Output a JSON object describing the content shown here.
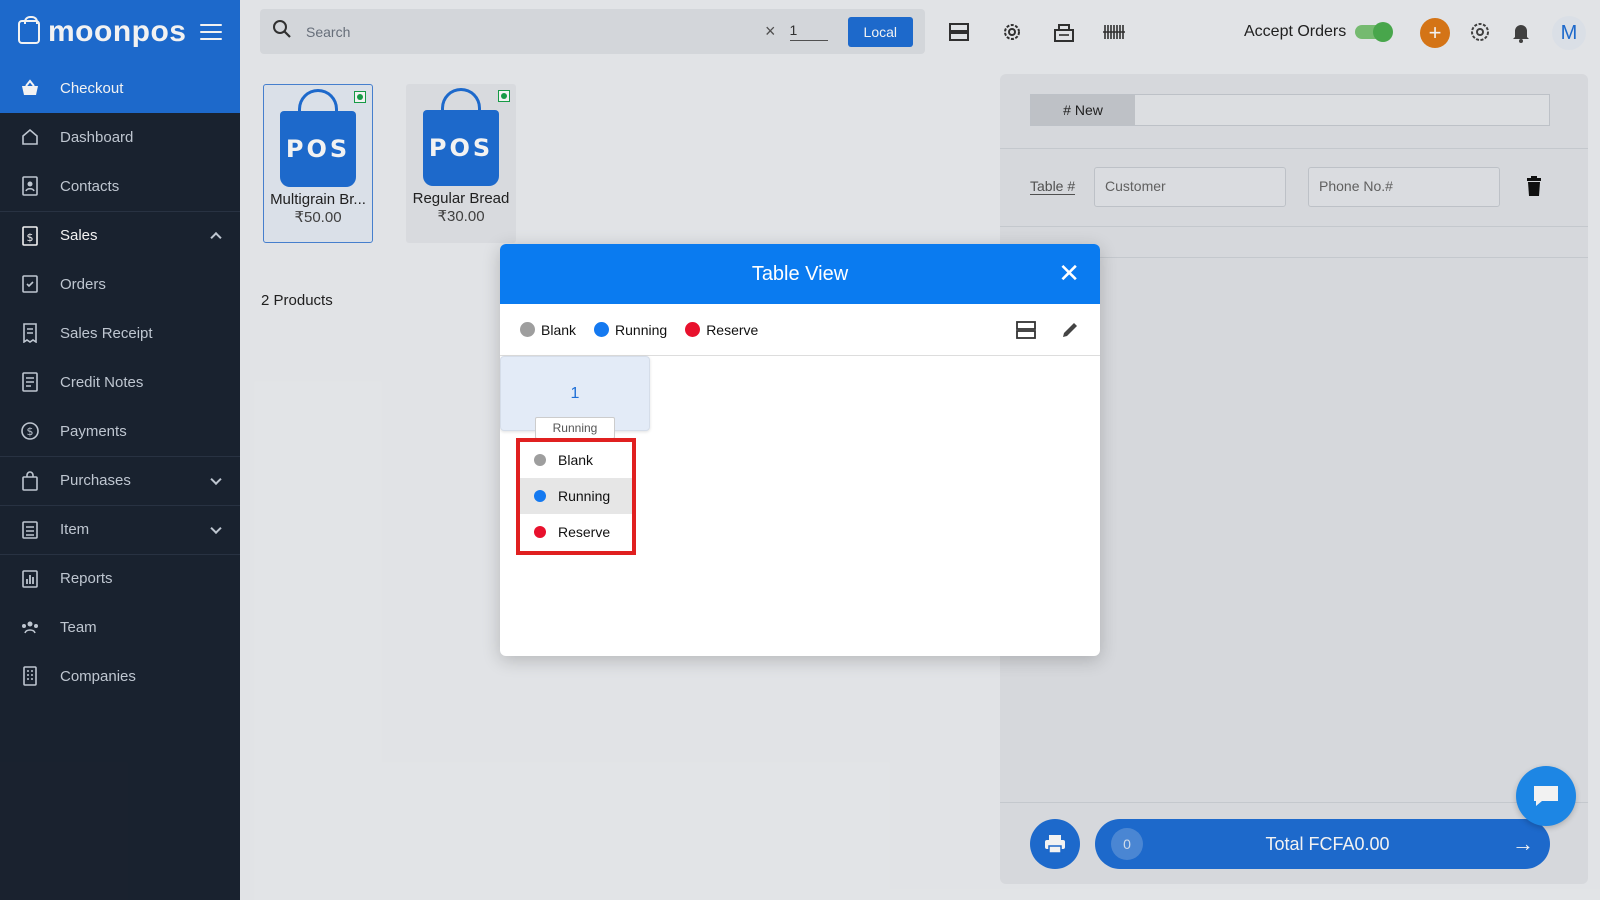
{
  "brand": {
    "name": "moonpos"
  },
  "sidebar": {
    "items": [
      {
        "label": "Checkout",
        "icon": "basket-icon"
      },
      {
        "label": "Dashboard",
        "icon": "home-icon"
      },
      {
        "label": "Contacts",
        "icon": "contacts-icon"
      },
      {
        "label": "Sales",
        "icon": "dollar-file-icon"
      },
      {
        "label": "Orders",
        "icon": "clipboard-check-icon"
      },
      {
        "label": "Sales Receipt",
        "icon": "receipt-icon"
      },
      {
        "label": "Credit Notes",
        "icon": "note-icon"
      },
      {
        "label": "Payments",
        "icon": "dollar-circle-icon"
      },
      {
        "label": "Purchases",
        "icon": "bag-icon"
      },
      {
        "label": "Item",
        "icon": "list-icon"
      },
      {
        "label": "Reports",
        "icon": "bar-chart-icon"
      },
      {
        "label": "Team",
        "icon": "team-icon"
      },
      {
        "label": "Companies",
        "icon": "building-icon"
      }
    ]
  },
  "topbar": {
    "search_placeholder": "Search",
    "clear": "×",
    "quantity": "1",
    "local_label": "Local",
    "accept_orders_label": "Accept Orders",
    "accept_orders_on": true,
    "plus": "+",
    "avatar_initial": "M"
  },
  "products": {
    "items": [
      {
        "name": "Multigrain Br...",
        "price": "₹50.00",
        "logo_text": "POS"
      },
      {
        "name": "Regular Bread",
        "price": "₹30.00",
        "logo_text": "POS"
      }
    ],
    "count_label": "2 Products"
  },
  "cart": {
    "tab_new": "# New",
    "table_label": "Table #",
    "customer_placeholder": "Customer",
    "phone_placeholder": "Phone No.#",
    "item_count": "0",
    "total_label": "Total FCFA0.00",
    "arrow": "→"
  },
  "modal": {
    "title": "Table View",
    "close": "✕",
    "legend": [
      {
        "label": "Blank",
        "color": "#9e9e9e"
      },
      {
        "label": "Running",
        "color": "#1479f0"
      },
      {
        "label": "Reserve",
        "color": "#e8112d"
      }
    ],
    "table": {
      "number": "1",
      "status": "Running"
    },
    "status_options": [
      {
        "label": "Blank",
        "color": "#9e9e9e"
      },
      {
        "label": "Running",
        "color": "#1479f0"
      },
      {
        "label": "Reserve",
        "color": "#e8112d"
      }
    ]
  },
  "colors": {
    "primary": "#1f6fd6",
    "modal_header": "#0a7bf0",
    "sidebar_bg": "#1b2432",
    "highlight_box": "#e02020",
    "add_button": "#e07b18"
  }
}
